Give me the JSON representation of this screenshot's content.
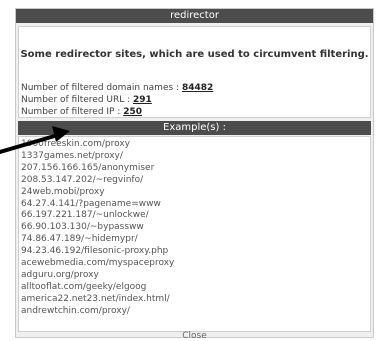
{
  "dialog": {
    "title": "redirector",
    "headline": "Some redirector sites, which are used to circumvent filtering.",
    "stats": [
      {
        "label": "Number of filtered domain names : ",
        "value": "84482"
      },
      {
        "label": "Number of filtered URL : ",
        "value": "291"
      },
      {
        "label": "Number of filtered IP : ",
        "value": "250"
      }
    ],
    "examples_header": "Example(s) :",
    "examples": [
      "1000freeskin.com/proxy",
      "1337games.net/proxy/",
      "207.156.166.165/anonymiser",
      "208.53.147.202/~regvinfo/",
      "24web.mobi/proxy",
      "64.27.4.141/?pagename=www",
      "66.197.221.187/~unlockwe/",
      "66.90.103.130/~bypassww",
      "74.86.47.189/~hidemypr/",
      "94.23.46.192/filesonic-proxy.php",
      "acewebmedia.com/myspaceproxy",
      "adguru.org/proxy",
      "alltooflat.com/geeky/elgoog",
      "america22.net23.net/index.html/",
      "andrewtchin.com/proxy/"
    ],
    "close_label": "Close"
  }
}
